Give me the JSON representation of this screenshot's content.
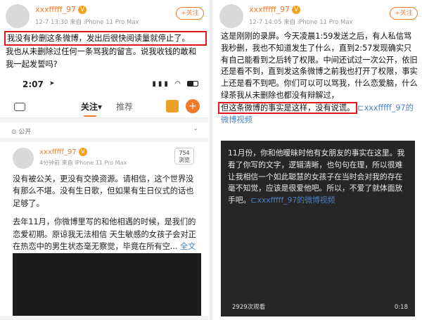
{
  "left_post": {
    "username": "xxxfffff_97",
    "vip_badge": "V",
    "meta": "12-7 13:30   来自 iPhone 11 Pro Max",
    "follow_label": "+关注",
    "highlighted_text": "我没有秒删这条微博，发出后很快阅读量就停止了。",
    "text_rest": "我也从未删除过任何一条骂我的留言。说我收钱的敢和我一起发誓吗?"
  },
  "phone": {
    "time": "2:07",
    "nav_active": "关注▾",
    "nav_other": "推荐",
    "plus_label": "+",
    "public_label": "⊙ 公开",
    "card_username": "xxxfffff_97",
    "card_meta": "4分钟前   来自 iPhone 11 Pro Max",
    "view_count_num": "754",
    "view_count_label": "浏览",
    "para1": "没有被公关，更没有交换资源。请相信，这个世界没有那么不堪。没有生日歌，但如果有生日仪式的话也足够了。",
    "para2": "去年11月，你微博里写的和他相遇的时候，是我们的恋爱初期。原谅我无法相信 天生敏感的女孩子会对正在热恋中的男生状态毫无察觉，毕竟在所有空...",
    "para2_link": "全文"
  },
  "right_post": {
    "username": "xxxfffff_97",
    "vip_badge": "V",
    "meta": "12-7 14:05   来自 iPhone 11 Pro Max",
    "follow_label": "+关注",
    "text_main": "这是刚刚的录屏。今天凌晨1:59发送之后，有人私信骂我秒删，我也不知道发生了什么，直到2:57发现确实只有自己能看到之后转了权限。中间还试过一次公开，依旧还是看不到，直到发这条微博之前我也打开了权限，事实上还是看不到吧。你们可以可以骂我，什么恋爱脑，什么绿茶我从未删除也都没有辩解过，",
    "highlighted_text": "但这条微博的事实是这样，没有说谎。",
    "link_text": "xxxfffff_97的微博视频",
    "video_text": "11月份，你和他暧昧时他有女朋友的事实在这里。我看了你写的文字，逻辑清晰，也句句在理，所以很难让我相信一个如此聪慧的女孩子在当时会对我的存在毫不知觉，应该是很爱他吧。所以，不爱了就体面放手吧。",
    "video_link": "xxxfffff_97的微博视频",
    "views": "2929次观看",
    "duration": "0:18"
  }
}
